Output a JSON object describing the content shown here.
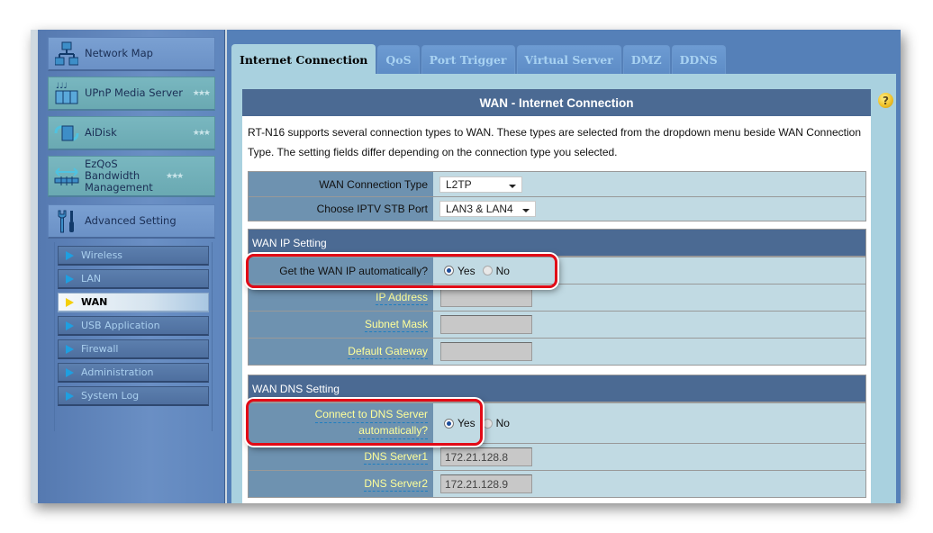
{
  "sidebar": {
    "main_menu": [
      {
        "label": "Network Map",
        "icon": "network-map-icon"
      },
      {
        "label": "UPnP Media Server",
        "icon": "media-server-icon",
        "stars": "★★★"
      },
      {
        "label": "AiDisk",
        "icon": "aidisk-icon",
        "stars": "★★★"
      },
      {
        "label": "EzQoS Bandwidth Management",
        "icon": "bandwidth-icon",
        "stars": "★★★"
      },
      {
        "label": "Advanced Setting",
        "icon": "wrench-icon"
      }
    ],
    "sub_menu": [
      {
        "label": "Wireless",
        "active": false
      },
      {
        "label": "LAN",
        "active": false
      },
      {
        "label": "WAN",
        "active": true
      },
      {
        "label": "USB Application",
        "active": false
      },
      {
        "label": "Firewall",
        "active": false
      },
      {
        "label": "Administration",
        "active": false
      },
      {
        "label": "System Log",
        "active": false
      }
    ]
  },
  "tabs": [
    {
      "label": "Internet Connection",
      "active": true
    },
    {
      "label": "QoS",
      "active": false
    },
    {
      "label": "Port Trigger",
      "active": false
    },
    {
      "label": "Virtual Server",
      "active": false
    },
    {
      "label": "DMZ",
      "active": false
    },
    {
      "label": "DDNS",
      "active": false
    }
  ],
  "help_icon": "?",
  "panel": {
    "title": "WAN - Internet Connection",
    "description": "RT-N16 supports several connection types to WAN. These types are selected from the dropdown menu beside WAN Connection Type. The setting fields differ depending on the connection type you selected.",
    "connection": {
      "wan_type_label": "WAN Connection Type",
      "wan_type_value": "L2TP",
      "iptv_label": "Choose IPTV STB Port",
      "iptv_value": "LAN3 & LAN4"
    },
    "wan_ip": {
      "section_title": "WAN IP Setting",
      "auto_label": "Get the WAN IP automatically?",
      "yes_label": "Yes",
      "no_label": "No",
      "selected": "Yes",
      "ip_address_label": "IP Address",
      "ip_address_value": "",
      "subnet_mask_label": "Subnet Mask",
      "subnet_mask_value": "",
      "gateway_label": "Default Gateway",
      "gateway_value": ""
    },
    "wan_dns": {
      "section_title": "WAN DNS Setting",
      "auto_label_line1": "Connect to DNS Server",
      "auto_label_line2": "automatically?",
      "yes_label": "Yes",
      "no_label": "No",
      "selected": "Yes",
      "dns1_label": "DNS Server1",
      "dns1_value": "172.21.128.8",
      "dns2_label": "DNS Server2",
      "dns2_value": "172.21.128.9"
    }
  },
  "colors": {
    "highlight": "#e20a16",
    "panel_header": "#4b6a93",
    "content_bg": "#a9d1df",
    "active_arrow": "#f4cf0a"
  }
}
